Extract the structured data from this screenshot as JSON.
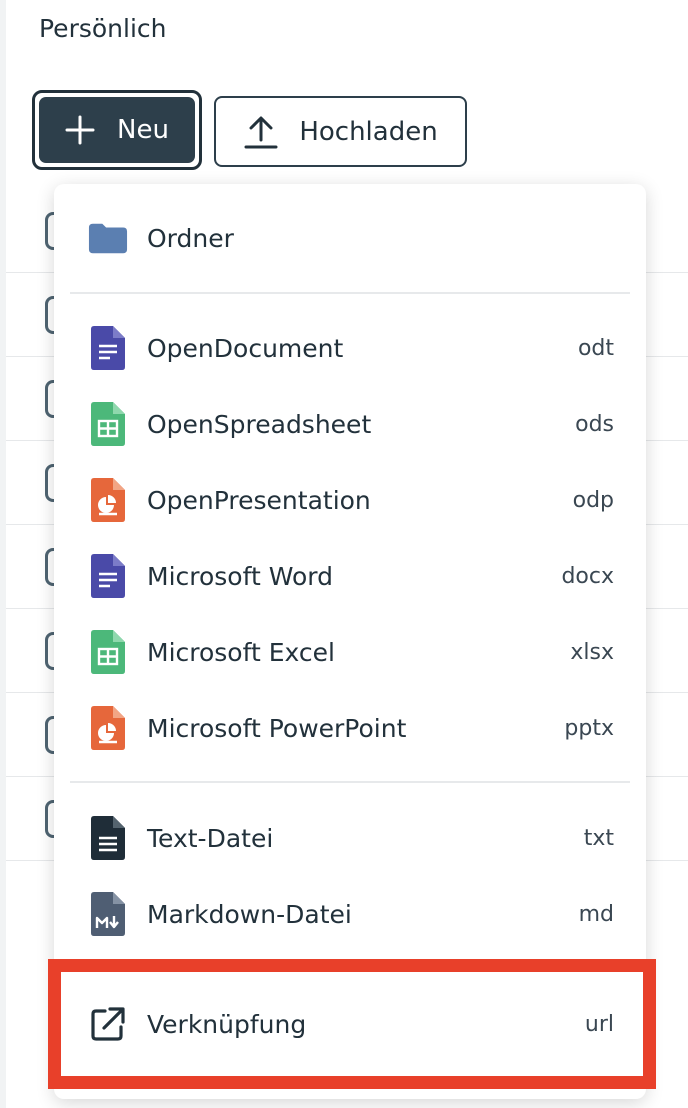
{
  "breadcrumb": "Persönlich",
  "toolbar": {
    "new_label": "Neu",
    "upload_label": "Hochladen"
  },
  "menu": {
    "folder": {
      "label": "Ordner",
      "icon": "folder-icon",
      "color": "#5b7fb1"
    },
    "documents": [
      {
        "label": "OpenDocument",
        "ext": "odt",
        "icon": "document-icon",
        "color": "#4a4aa8"
      },
      {
        "label": "OpenSpreadsheet",
        "ext": "ods",
        "icon": "spreadsheet-icon",
        "color": "#4cb87a"
      },
      {
        "label": "OpenPresentation",
        "ext": "odp",
        "icon": "presentation-icon",
        "color": "#e6673b"
      },
      {
        "label": "Microsoft Word",
        "ext": "docx",
        "icon": "document-icon",
        "color": "#4a4aa8"
      },
      {
        "label": "Microsoft Excel",
        "ext": "xlsx",
        "icon": "spreadsheet-icon",
        "color": "#4cb87a"
      },
      {
        "label": "Microsoft PowerPoint",
        "ext": "pptx",
        "icon": "presentation-icon",
        "color": "#e6673b"
      }
    ],
    "text_files": [
      {
        "label": "Text-Datei",
        "ext": "txt",
        "icon": "text-file-icon",
        "color": "#1f2d38"
      },
      {
        "label": "Markdown-Datei",
        "ext": "md",
        "icon": "markdown-file-icon",
        "color": "#4f5e73"
      }
    ],
    "link": {
      "label": "Verknüpfung",
      "ext": "url",
      "icon": "external-link-icon",
      "color": "#22313b"
    }
  },
  "highlight_color": "#e8402a"
}
